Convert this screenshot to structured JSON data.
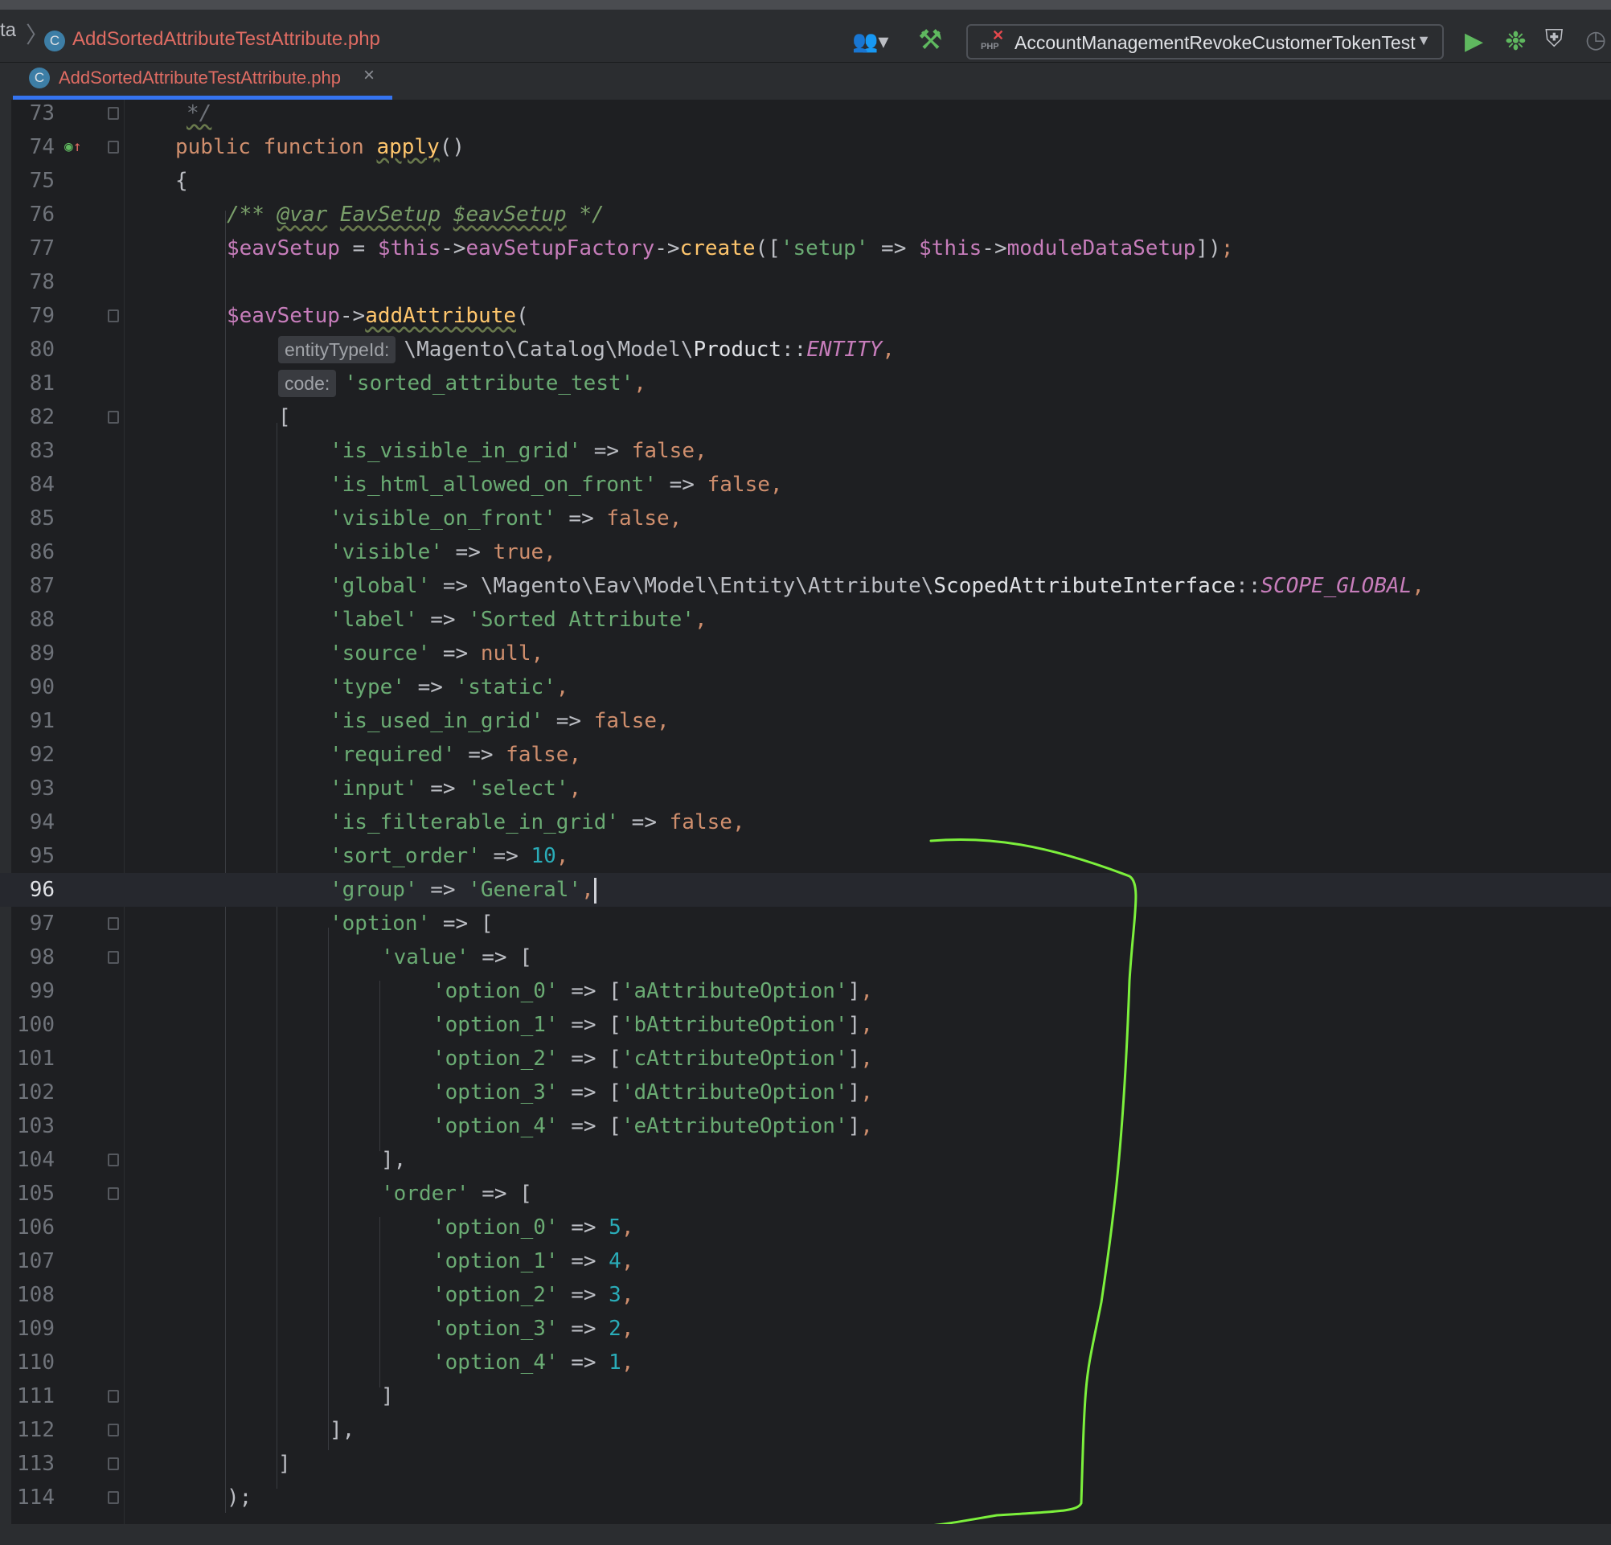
{
  "breadcrumb": {
    "partial": "ta",
    "file": "AddSortedAttributeTestAttribute.php"
  },
  "toolbar": {
    "run_config": "AccountManagementRevokeCustomerTokenTest",
    "run_config_icon_text": "PHP",
    "icons": [
      "user-icon",
      "build-hammer-icon",
      "run-icon",
      "debug-icon",
      "coverage-icon",
      "more-run-icon"
    ]
  },
  "tab": {
    "label": "AddSortedAttributeTestAttribute.php",
    "icon_letter": "C"
  },
  "editor": {
    "current_line": "96",
    "lines": {
      "73": "73",
      "74": "74",
      "75": "75",
      "76": "76",
      "77": "77",
      "78": "78",
      "79": "79",
      "80": "80",
      "81": "81",
      "82": "82",
      "83": "83",
      "84": "84",
      "85": "85",
      "86": "86",
      "87": "87",
      "88": "88",
      "89": "89",
      "90": "90",
      "91": "91",
      "92": "92",
      "93": "93",
      "94": "94",
      "95": "95",
      "96": "96",
      "97": "97",
      "98": "98",
      "99": "99",
      "100": "100",
      "101": "101",
      "102": "102",
      "103": "103",
      "104": "104",
      "105": "105",
      "106": "106",
      "107": "107",
      "108": "108",
      "109": "109",
      "110": "110",
      "111": "111",
      "112": "112",
      "113": "113",
      "114": "114"
    },
    "hints": {
      "entity": "entityTypeId:",
      "code": "code:"
    },
    "t": {
      "l73": "*/",
      "l74_public": "public",
      "l74_function": "function",
      "l74_name": "apply",
      "l74_rest": "()",
      "l75": "{",
      "l76_open": "/** ",
      "l76_tag": "@var",
      "l76_type": "EavSetup",
      "l76_var": "$eavSetup",
      "l76_close": " */",
      "l77_var": "$eavSetup",
      "l77_eq": " = ",
      "l77_this": "$this",
      "l77_arrow": "->",
      "l77_prop": "eavSetupFactory",
      "l77_arrow2": "->",
      "l77_call": "create",
      "l77_open": "([",
      "l77_key": "'setup'",
      "l77_fat": " => ",
      "l77_this2": "$this",
      "l77_arrow3": "->",
      "l77_prop2": "moduleDataSetup",
      "l77_close": "])",
      "l77_semi": ";",
      "l79_var": "$eavSetup",
      "l79_arrow": "->",
      "l79_call": "addAttribute",
      "l79_open": "(",
      "l80_ns": "\\Magento\\Catalog\\Model\\",
      "l80_cls": "Product",
      "l80_dc": "::",
      "l80_const": "ENTITY",
      "l80_comma": ",",
      "l81_str": "'sorted_attribute_test'",
      "l81_comma": ",",
      "l82": "[",
      "l83_key": "'is_visible_in_grid'",
      "l83_val": "false",
      "l84_key": "'is_html_allowed_on_front'",
      "l84_val": "false",
      "l85_key": "'visible_on_front'",
      "l85_val": "false",
      "l86_key": "'visible'",
      "l86_val": "true",
      "l87_key": "'global'",
      "l87_ns": "\\Magento\\Eav\\Model\\Entity\\Attribute\\",
      "l87_cls": "ScopedAttributeInterface",
      "l87_dc": "::",
      "l87_const": "SCOPE_GLOBAL",
      "l88_key": "'label'",
      "l88_val": "'Sorted Attribute'",
      "l89_key": "'source'",
      "l89_val": "null",
      "l90_key": "'type'",
      "l90_val": "'static'",
      "l91_key": "'is_used_in_grid'",
      "l91_val": "false",
      "l92_key": "'required'",
      "l92_val": "false",
      "l93_key": "'input'",
      "l93_val": "'select'",
      "l94_key": "'is_filterable_in_grid'",
      "l94_val": "false",
      "l95_key": "'sort_order'",
      "l95_val": "10",
      "l96_key": "'group'",
      "l96_val": "'General'",
      "l97_key": "'option'",
      "l97_open": "[",
      "l98_key": "'value'",
      "l98_open": "[",
      "l99_key": "'option_0'",
      "l99_val": "'aAttributeOption'",
      "l100_key": "'option_1'",
      "l100_val": "'bAttributeOption'",
      "l101_key": "'option_2'",
      "l101_val": "'cAttributeOption'",
      "l102_key": "'option_3'",
      "l102_val": "'dAttributeOption'",
      "l103_key": "'option_4'",
      "l103_val": "'eAttributeOption'",
      "l104": "],",
      "l105_key": "'order'",
      "l105_open": "[",
      "l106_key": "'option_0'",
      "l106_val": "5",
      "l107_key": "'option_1'",
      "l107_val": "4",
      "l108_key": "'option_2'",
      "l108_val": "3",
      "l109_key": "'option_3'",
      "l109_val": "2",
      "l110_key": "'option_4'",
      "l110_val": "1",
      "l111": "]",
      "l112": "],",
      "l113": "]",
      "l114": ");",
      "fat": " => ",
      "comma": ",",
      "br_open": "[",
      "br_close": "]"
    }
  },
  "annotation": {
    "color": "#7cf03c"
  },
  "colors": {
    "background": "#1e1f22",
    "keyword": "#cf8e6d",
    "string": "#6aab73",
    "number": "#2aacb8",
    "variable": "#c77dbb",
    "function": "#ffc66d",
    "tab_accent": "#3574f0"
  }
}
